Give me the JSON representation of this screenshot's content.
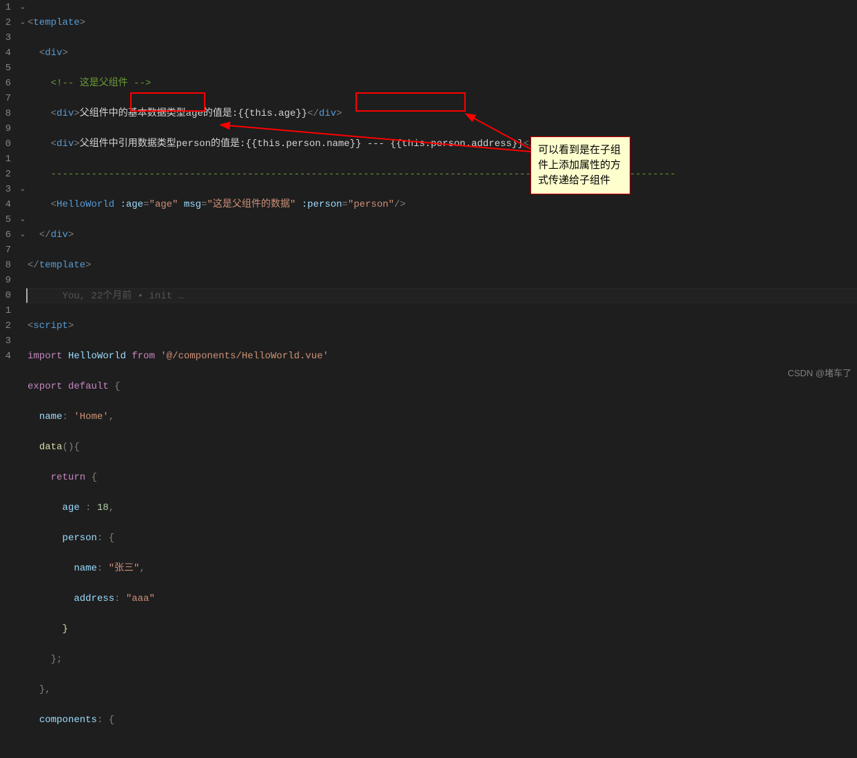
{
  "gutter": [
    "1",
    "2",
    "3",
    "4",
    "5",
    "6",
    "7",
    "8",
    "9",
    "0",
    "1",
    "2",
    "3",
    "4",
    "5",
    "6",
    "7",
    "8",
    "9",
    "0",
    "1",
    "2",
    "3",
    "4"
  ],
  "fold": {
    "1": "⌄",
    "2": "⌄",
    "5": "",
    "10": "",
    "12": "",
    "13": "⌄",
    "15": "⌄",
    "16": "⌄"
  },
  "blame": "You, 22个月前 • init …",
  "line1": {
    "tag": "template"
  },
  "line2": {
    "tag": "div"
  },
  "line3": {
    "cmt": "<!-- 这是父组件 -->"
  },
  "line4": {
    "tag": "div",
    "txt": "父组件中的基本数据类型age的值是:{{this.age}}"
  },
  "line5": {
    "tag": "div",
    "txt": "父组件中引用数据类型person的值是:{{this.person.name}} --- {{this.person.address}}"
  },
  "line6": {
    "cmt": "------------------------------------------------------------------------------------------------------------"
  },
  "line7": {
    "tag": "HelloWorld",
    "a1n": ":age",
    "a1v": "\"age\"",
    "a2n": "msg",
    "a2v": "\"这是父组件的数据\"",
    "a3n": ":person",
    "a3v": "\"person\""
  },
  "line8": {
    "tag": "div"
  },
  "line9": {
    "tag": "template"
  },
  "line11": {
    "tag": "script"
  },
  "line12": {
    "kw": "import",
    "id": "HelloWorld",
    "kw2": "from",
    "str": "'@/components/HelloWorld.vue'"
  },
  "line13": {
    "kw1": "export",
    "kw2": "default"
  },
  "line14": {
    "id": "name",
    "str": "'Home'"
  },
  "line15": {
    "fn": "data"
  },
  "line16": {
    "kw": "return"
  },
  "line17": {
    "id": "age",
    "num": "18"
  },
  "line18": {
    "id": "person"
  },
  "line19": {
    "id": "name",
    "str": "\"张三\""
  },
  "line20": {
    "id": "address",
    "str": "\"aaa\""
  },
  "line24": {
    "id": "components"
  },
  "callout": "可以看到是在子组件上添加属性的方式传递给子组件",
  "watermark": "CSDN @堵车了"
}
